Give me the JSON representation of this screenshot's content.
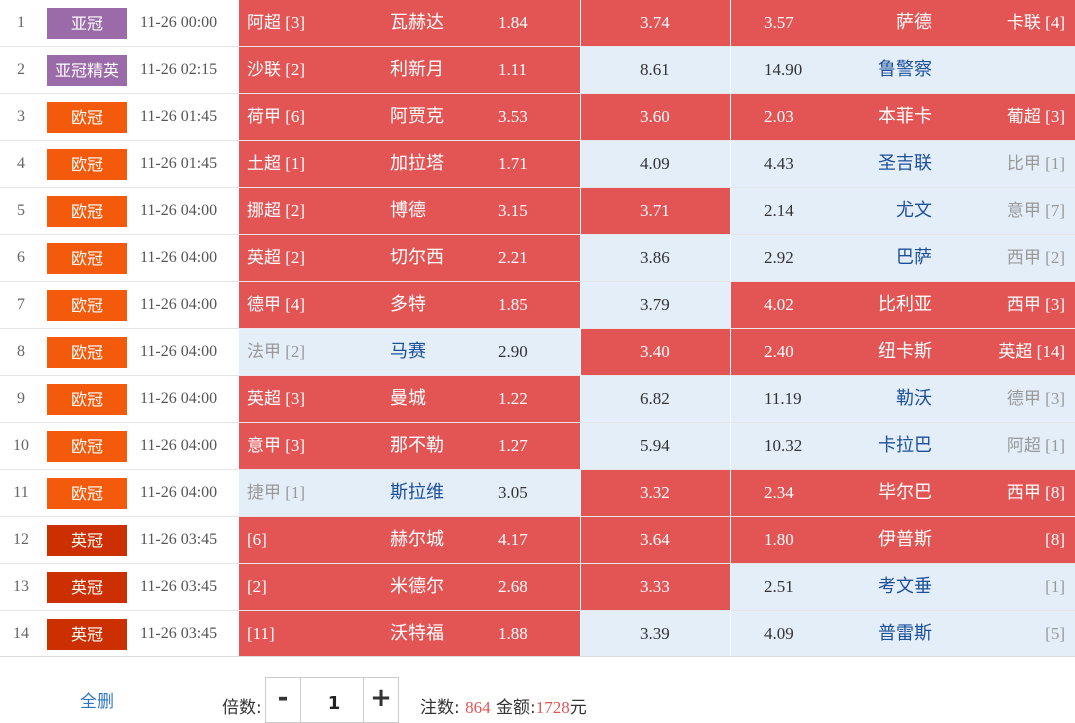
{
  "colors": {
    "win": "#e35555",
    "lose": "#e3eef9",
    "badge_afc": "#9b6aa8",
    "badge_ucl": "#f45a0c",
    "badge_efl": "#cc3000",
    "link": "#2e74c4"
  },
  "matches": [
    {
      "no": "1",
      "league": "亚冠",
      "badge": "afc",
      "time": "11-26 00:00",
      "home_rank": "阿超 [3]",
      "home": "瓦赫达",
      "odds_home": "1.84",
      "odds_draw": "3.74",
      "odds_away": "3.57",
      "away": "萨德",
      "away_rank": "卡联 [4]",
      "sel_home": true,
      "sel_draw": true,
      "sel_away": true
    },
    {
      "no": "2",
      "league": "亚冠精英",
      "badge": "afc",
      "time": "11-26 02:15",
      "home_rank": "沙联 [2]",
      "home": "利新月",
      "odds_home": "1.11",
      "odds_draw": "8.61",
      "odds_away": "14.90",
      "away": "鲁警察",
      "away_rank": "",
      "sel_home": true,
      "sel_draw": false,
      "sel_away": false
    },
    {
      "no": "3",
      "league": "欧冠",
      "badge": "ucl",
      "time": "11-26 01:45",
      "home_rank": "荷甲 [6]",
      "home": "阿贾克",
      "odds_home": "3.53",
      "odds_draw": "3.60",
      "odds_away": "2.03",
      "away": "本菲卡",
      "away_rank": "葡超 [3]",
      "sel_home": true,
      "sel_draw": true,
      "sel_away": true
    },
    {
      "no": "4",
      "league": "欧冠",
      "badge": "ucl",
      "time": "11-26 01:45",
      "home_rank": "土超 [1]",
      "home": "加拉塔",
      "odds_home": "1.71",
      "odds_draw": "4.09",
      "odds_away": "4.43",
      "away": "圣吉联",
      "away_rank": "比甲 [1]",
      "sel_home": true,
      "sel_draw": false,
      "sel_away": false
    },
    {
      "no": "5",
      "league": "欧冠",
      "badge": "ucl",
      "time": "11-26 04:00",
      "home_rank": "挪超 [2]",
      "home": "博德",
      "odds_home": "3.15",
      "odds_draw": "3.71",
      "odds_away": "2.14",
      "away": "尤文",
      "away_rank": "意甲 [7]",
      "sel_home": true,
      "sel_draw": true,
      "sel_away": false
    },
    {
      "no": "6",
      "league": "欧冠",
      "badge": "ucl",
      "time": "11-26 04:00",
      "home_rank": "英超 [2]",
      "home": "切尔西",
      "odds_home": "2.21",
      "odds_draw": "3.86",
      "odds_away": "2.92",
      "away": "巴萨",
      "away_rank": "西甲 [2]",
      "sel_home": true,
      "sel_draw": false,
      "sel_away": false
    },
    {
      "no": "7",
      "league": "欧冠",
      "badge": "ucl",
      "time": "11-26 04:00",
      "home_rank": "德甲 [4]",
      "home": "多特",
      "odds_home": "1.85",
      "odds_draw": "3.79",
      "odds_away": "4.02",
      "away": "比利亚",
      "away_rank": "西甲 [3]",
      "sel_home": true,
      "sel_draw": false,
      "sel_away": true
    },
    {
      "no": "8",
      "league": "欧冠",
      "badge": "ucl",
      "time": "11-26 04:00",
      "home_rank": "法甲 [2]",
      "home": "马赛",
      "odds_home": "2.90",
      "odds_draw": "3.40",
      "odds_away": "2.40",
      "away": "纽卡斯",
      "away_rank": "英超 [14]",
      "sel_home": false,
      "sel_draw": true,
      "sel_away": true
    },
    {
      "no": "9",
      "league": "欧冠",
      "badge": "ucl",
      "time": "11-26 04:00",
      "home_rank": "英超 [3]",
      "home": "曼城",
      "odds_home": "1.22",
      "odds_draw": "6.82",
      "odds_away": "11.19",
      "away": "勒沃",
      "away_rank": "德甲 [3]",
      "sel_home": true,
      "sel_draw": false,
      "sel_away": false
    },
    {
      "no": "10",
      "league": "欧冠",
      "badge": "ucl",
      "time": "11-26 04:00",
      "home_rank": "意甲 [3]",
      "home": "那不勒",
      "odds_home": "1.27",
      "odds_draw": "5.94",
      "odds_away": "10.32",
      "away": "卡拉巴",
      "away_rank": "阿超 [1]",
      "sel_home": true,
      "sel_draw": false,
      "sel_away": false
    },
    {
      "no": "11",
      "league": "欧冠",
      "badge": "ucl",
      "time": "11-26 04:00",
      "home_rank": "捷甲 [1]",
      "home": "斯拉维",
      "odds_home": "3.05",
      "odds_draw": "3.32",
      "odds_away": "2.34",
      "away": "毕尔巴",
      "away_rank": "西甲 [8]",
      "sel_home": false,
      "sel_draw": true,
      "sel_away": true
    },
    {
      "no": "12",
      "league": "英冠",
      "badge": "efl",
      "time": "11-26 03:45",
      "home_rank": "[6]",
      "home": "赫尔城",
      "odds_home": "4.17",
      "odds_draw": "3.64",
      "odds_away": "1.80",
      "away": "伊普斯",
      "away_rank": "[8]",
      "sel_home": true,
      "sel_draw": true,
      "sel_away": true
    },
    {
      "no": "13",
      "league": "英冠",
      "badge": "efl",
      "time": "11-26 03:45",
      "home_rank": "[2]",
      "home": "米德尔",
      "odds_home": "2.68",
      "odds_draw": "3.33",
      "odds_away": "2.51",
      "away": "考文垂",
      "away_rank": "[1]",
      "sel_home": true,
      "sel_draw": true,
      "sel_away": false
    },
    {
      "no": "14",
      "league": "英冠",
      "badge": "efl",
      "time": "11-26 03:45",
      "home_rank": "[11]",
      "home": "沃特福",
      "odds_home": "1.88",
      "odds_draw": "3.39",
      "odds_away": "4.09",
      "away": "普雷斯",
      "away_rank": "[5]",
      "sel_home": true,
      "sel_draw": false,
      "sel_away": false
    }
  ],
  "footer": {
    "clear_all": "全删",
    "multiplier_label": "倍数:",
    "minus": "-",
    "plus": "+",
    "multiplier_value": "1",
    "bets_label": "注数:",
    "bets_value": "864",
    "amount_label": "金额:",
    "amount_value": "1728",
    "amount_unit": "元"
  }
}
